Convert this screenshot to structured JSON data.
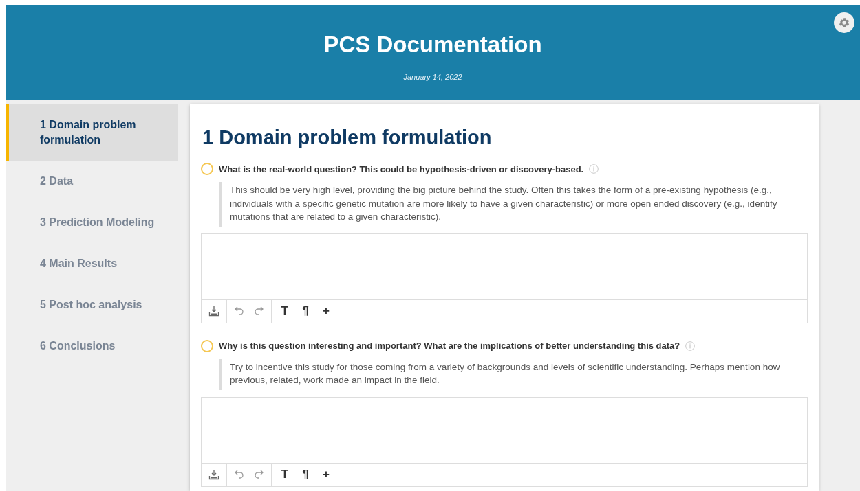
{
  "header": {
    "title": "PCS Documentation",
    "date": "January 14, 2022"
  },
  "sidebar": {
    "items": [
      {
        "label": "1 Domain problem formulation",
        "selected": true
      },
      {
        "label": "2 Data",
        "selected": false
      },
      {
        "label": "3 Prediction Modeling",
        "selected": false
      },
      {
        "label": "4 Main Results",
        "selected": false
      },
      {
        "label": "5 Post hoc analysis",
        "selected": false
      },
      {
        "label": "6 Conclusions",
        "selected": false
      }
    ]
  },
  "section": {
    "title": "1 Domain problem formulation",
    "questions": [
      {
        "question": "What is the real-world question? This could be hypothesis-driven or discovery-based.",
        "answered": false,
        "hint": "This should be very high level, providing the big picture behind the study. Often this takes the form of a pre-existing hypothesis (e.g., individuals with a specific genetic mutation are more likely to have a given characteristic) or more open ended discovery (e.g., identify mutations that are related to a given characteristic).",
        "toolbar": [
          "T",
          "¶",
          "+"
        ]
      },
      {
        "question": "Why is this question interesting and important? What are the implications of better understanding this data?",
        "answered": false,
        "hint": "Try to incentive this study for those coming from a variety of backgrounds and levels of scientific understanding. Perhaps mention how previous, related, work made an impact in the field.",
        "toolbar": [
          "T",
          "¶",
          "+"
        ]
      }
    ]
  }
}
